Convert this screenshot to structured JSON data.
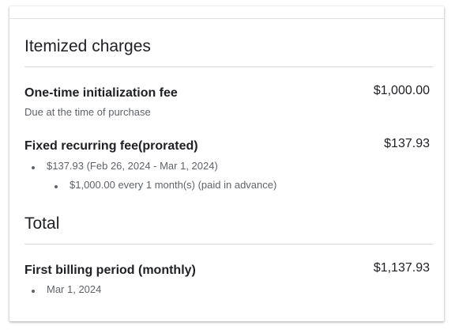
{
  "itemized": {
    "title": "Itemized charges",
    "one_time": {
      "title": "One-time initialization fee",
      "amount": "$1,000.00",
      "subtitle": "Due at the time of purchase"
    },
    "recurring": {
      "title": "Fixed recurring fee(prorated)",
      "amount": "$137.93",
      "bullet_1": "$137.93 (Feb 26, 2024 - Mar 1, 2024)",
      "bullet_2": "$1,000.00 every 1 month(s) (paid in advance)"
    }
  },
  "total": {
    "title": "Total",
    "first_period": {
      "title": "First billing period (monthly)",
      "amount": "$1,137.93",
      "bullet_1": "Mar 1, 2024"
    }
  }
}
